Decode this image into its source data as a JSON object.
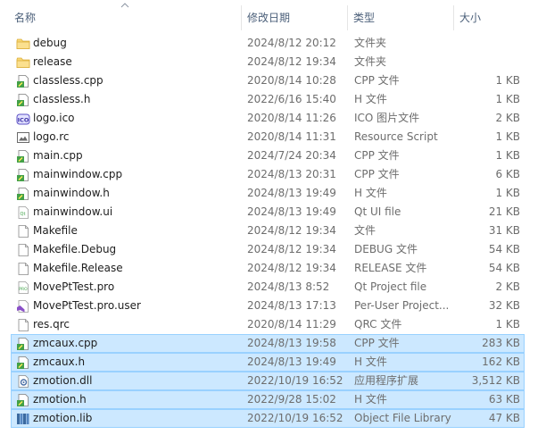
{
  "columns": {
    "name": "名称",
    "date": "修改日期",
    "type": "类型",
    "size": "大小"
  },
  "files": [
    {
      "name": "debug",
      "date": "2024/8/12 20:12",
      "type": "文件夹",
      "size": "",
      "icon": "folder-icon",
      "selected": false
    },
    {
      "name": "release",
      "date": "2024/8/12 19:34",
      "type": "文件夹",
      "size": "",
      "icon": "folder-icon",
      "selected": false
    },
    {
      "name": "classless.cpp",
      "date": "2020/8/14 10:28",
      "type": "CPP 文件",
      "size": "1 KB",
      "icon": "cpp-file-icon",
      "selected": false
    },
    {
      "name": "classless.h",
      "date": "2022/6/16 15:40",
      "type": "H 文件",
      "size": "1 KB",
      "icon": "header-file-icon",
      "selected": false
    },
    {
      "name": "logo.ico",
      "date": "2020/8/14 11:26",
      "type": "ICO 图片文件",
      "size": "2 KB",
      "icon": "ico-image-icon",
      "selected": false
    },
    {
      "name": "logo.rc",
      "date": "2020/8/14 11:31",
      "type": "Resource Script",
      "size": "1 KB",
      "icon": "resource-script-icon",
      "selected": false
    },
    {
      "name": "main.cpp",
      "date": "2024/7/24 20:34",
      "type": "CPP 文件",
      "size": "1 KB",
      "icon": "cpp-file-icon",
      "selected": false
    },
    {
      "name": "mainwindow.cpp",
      "date": "2024/8/13 20:31",
      "type": "CPP 文件",
      "size": "6 KB",
      "icon": "cpp-file-icon",
      "selected": false
    },
    {
      "name": "mainwindow.h",
      "date": "2024/8/13 19:49",
      "type": "H 文件",
      "size": "1 KB",
      "icon": "header-file-icon",
      "selected": false
    },
    {
      "name": "mainwindow.ui",
      "date": "2024/8/13 19:49",
      "type": "Qt UI file",
      "size": "21 KB",
      "icon": "qt-ui-file-icon",
      "selected": false
    },
    {
      "name": "Makefile",
      "date": "2024/8/12 19:34",
      "type": "文件",
      "size": "31 KB",
      "icon": "blank-file-icon",
      "selected": false
    },
    {
      "name": "Makefile.Debug",
      "date": "2024/8/12 19:34",
      "type": "DEBUG 文件",
      "size": "54 KB",
      "icon": "blank-file-icon",
      "selected": false
    },
    {
      "name": "Makefile.Release",
      "date": "2024/8/12 19:34",
      "type": "RELEASE 文件",
      "size": "54 KB",
      "icon": "blank-file-icon",
      "selected": false
    },
    {
      "name": "MovePtTest.pro",
      "date": "2024/8/13 8:52",
      "type": "Qt Project file",
      "size": "2 KB",
      "icon": "qt-project-file-icon",
      "selected": false
    },
    {
      "name": "MovePtTest.pro.user",
      "date": "2024/8/13 17:13",
      "type": "Per-User Project...",
      "size": "32 KB",
      "icon": "visual-studio-file-icon",
      "selected": false
    },
    {
      "name": "res.qrc",
      "date": "2020/8/14 11:29",
      "type": "QRC 文件",
      "size": "1 KB",
      "icon": "blank-file-icon",
      "selected": false
    },
    {
      "name": "zmcaux.cpp",
      "date": "2024/8/13 19:58",
      "type": "CPP 文件",
      "size": "283 KB",
      "icon": "cpp-file-icon",
      "selected": true
    },
    {
      "name": "zmcaux.h",
      "date": "2024/8/13 19:49",
      "type": "H 文件",
      "size": "162 KB",
      "icon": "header-file-icon",
      "selected": true
    },
    {
      "name": "zmotion.dll",
      "date": "2022/10/19 16:52",
      "type": "应用程序扩展",
      "size": "3,512 KB",
      "icon": "dll-file-icon",
      "selected": true
    },
    {
      "name": "zmotion.h",
      "date": "2022/9/28 15:02",
      "type": "H 文件",
      "size": "63 KB",
      "icon": "header-file-icon",
      "selected": true
    },
    {
      "name": "zmotion.lib",
      "date": "2022/10/19 16:52",
      "type": "Object File Library",
      "size": "47 KB",
      "icon": "library-file-icon",
      "selected": true
    }
  ]
}
